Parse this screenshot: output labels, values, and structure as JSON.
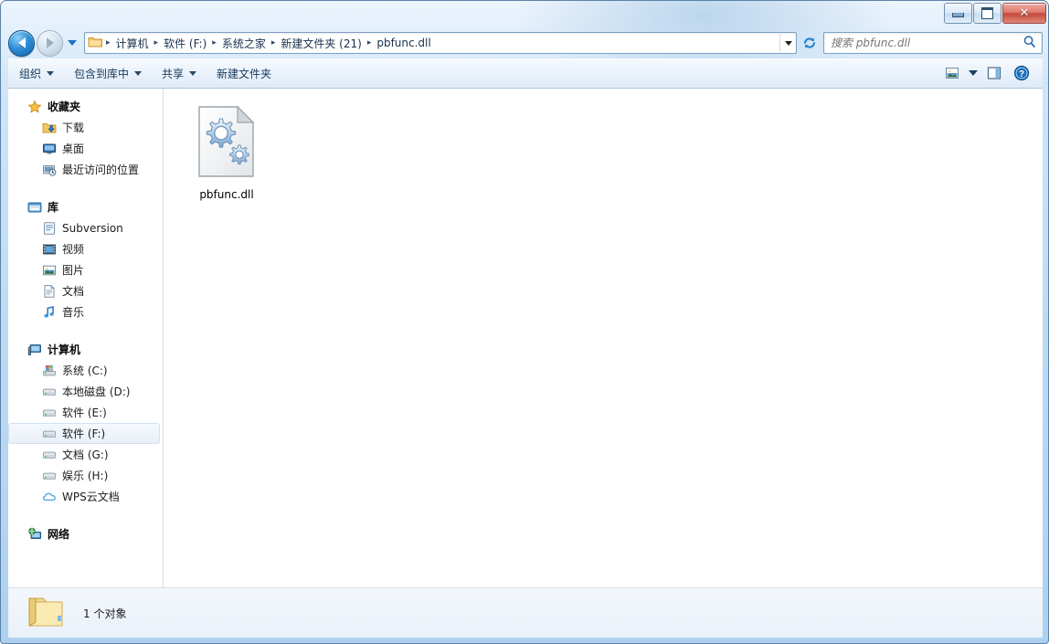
{
  "window": {
    "titlebar": {
      "title": "",
      "minimize_label": "最小化",
      "maximize_label": "最大化",
      "close_label": "关闭",
      "close_glyph": "✕"
    },
    "frame_color": "#aed0ee",
    "accent_color": "#1a73c4"
  },
  "address_bar": {
    "back_label": "后退",
    "forward_label": "前进",
    "recent_dropdown_label": "最近浏览的位置",
    "breadcrumbs": [
      {
        "label": "计算机"
      },
      {
        "label": "软件 (F:)"
      },
      {
        "label": "系统之家"
      },
      {
        "label": "新建文件夹 (21)"
      },
      {
        "label": "pbfunc.dll"
      }
    ],
    "separator": "▸",
    "path_dropdown_label": "以前的位置",
    "refresh_label": "刷新",
    "search": {
      "value": "",
      "placeholder": "搜索 pbfunc.dll",
      "icon": "search-icon"
    }
  },
  "toolbar": {
    "items": [
      {
        "label": "组织",
        "has_caret": true
      },
      {
        "label": "包含到库中",
        "has_caret": true
      },
      {
        "label": "共享",
        "has_caret": true
      },
      {
        "label": "新建文件夹",
        "has_caret": false
      }
    ],
    "right_items": [
      {
        "name": "change-view-icon",
        "label": "更改您的视图"
      },
      {
        "name": "view-dropdown-caret",
        "label": "视图选项"
      },
      {
        "name": "preview-pane-icon",
        "label": "显示预览窗格"
      },
      {
        "name": "help-icon",
        "label": "获取帮助"
      }
    ]
  },
  "navigation_pane": {
    "groups": [
      {
        "name": "favorites",
        "root": {
          "label": "收藏夹",
          "icon": "star-icon"
        },
        "items": [
          {
            "label": "下载",
            "icon": "downloads-icon"
          },
          {
            "label": "桌面",
            "icon": "desktop-icon"
          },
          {
            "label": "最近访问的位置",
            "icon": "recent-places-icon"
          }
        ]
      },
      {
        "name": "libraries",
        "root": {
          "label": "库",
          "icon": "library-icon"
        },
        "items": [
          {
            "label": "Subversion",
            "icon": "subversion-icon"
          },
          {
            "label": "视频",
            "icon": "videos-icon"
          },
          {
            "label": "图片",
            "icon": "pictures-icon"
          },
          {
            "label": "文档",
            "icon": "documents-icon"
          },
          {
            "label": "音乐",
            "icon": "music-icon"
          }
        ]
      },
      {
        "name": "computer",
        "root": {
          "label": "计算机",
          "icon": "computer-icon"
        },
        "items": [
          {
            "label": "系统 (C:)",
            "icon": "system-drive-icon",
            "selected": false
          },
          {
            "label": "本地磁盘 (D:)",
            "icon": "drive-icon",
            "selected": false
          },
          {
            "label": "软件 (E:)",
            "icon": "drive-icon",
            "selected": false
          },
          {
            "label": "软件 (F:)",
            "icon": "drive-icon",
            "selected": true
          },
          {
            "label": "文档 (G:)",
            "icon": "drive-icon",
            "selected": false
          },
          {
            "label": "娱乐 (H:)",
            "icon": "drive-icon",
            "selected": false
          },
          {
            "label": "WPS云文档",
            "icon": "cloud-icon",
            "selected": false
          }
        ]
      },
      {
        "name": "network",
        "root": {
          "label": "网络",
          "icon": "network-icon"
        },
        "items": []
      }
    ]
  },
  "content": {
    "files": [
      {
        "name": "pbfunc.dll",
        "icon": "dll-gear-icon",
        "selected": false
      }
    ]
  },
  "status_bar": {
    "icon": "folder-icon",
    "text": "1 个对象"
  }
}
